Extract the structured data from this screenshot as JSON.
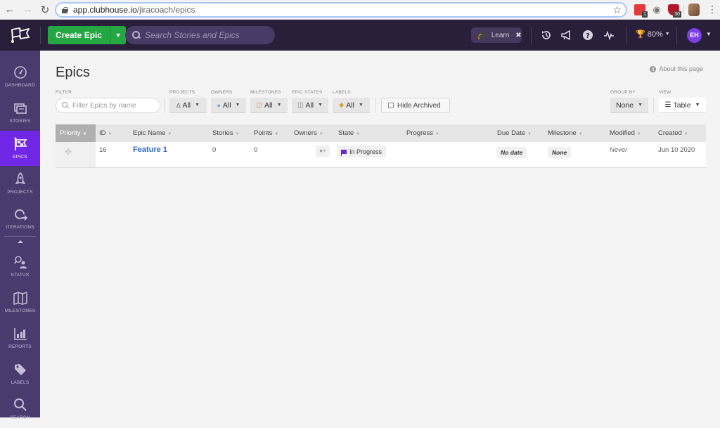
{
  "browser": {
    "url_host": "app.clubhouse.io",
    "url_path": "/jiracoach/epics",
    "extensions": [
      {
        "name": "red-extension",
        "badge": "1"
      },
      {
        "name": "camera-extension",
        "badge": ""
      },
      {
        "name": "shield-extension",
        "badge": "30"
      }
    ]
  },
  "topbar": {
    "create_label": "Create Epic",
    "search_placeholder": "Search Stories and Epics",
    "learn_label": "Learn",
    "progress_label": "80%",
    "avatar_initials": "EH"
  },
  "sidebar": {
    "items": [
      {
        "id": "dashboard",
        "label": "DASHBOARD",
        "icon": "gauge-icon"
      },
      {
        "id": "stories",
        "label": "STORIES",
        "icon": "cards-icon"
      },
      {
        "id": "epics",
        "label": "EPICS",
        "icon": "flag-icon",
        "active": true
      },
      {
        "id": "projects",
        "label": "PROJECTS",
        "icon": "rocket-icon"
      },
      {
        "id": "iterations",
        "label": "ITERATIONS",
        "icon": "loop-icon"
      },
      {
        "id": "status",
        "label": "STATUS",
        "icon": "people-icon"
      },
      {
        "id": "milestones",
        "label": "MILESTONES",
        "icon": "map-icon"
      },
      {
        "id": "reports",
        "label": "REPORTS",
        "icon": "bar-chart-icon"
      },
      {
        "id": "labels",
        "label": "LABELS",
        "icon": "tag-icon"
      },
      {
        "id": "search",
        "label": "SEARCH",
        "icon": "search-icon"
      }
    ]
  },
  "page": {
    "title": "Epics",
    "about_label": "About this page"
  },
  "filters": {
    "filter_label": "FILTER",
    "filter_placeholder": "Filter Epics by name",
    "projects": {
      "label": "PROJECTS",
      "value": "All"
    },
    "owners": {
      "label": "OWNERS",
      "value": "All"
    },
    "milestones": {
      "label": "MILESTONES",
      "value": "All"
    },
    "epic_states": {
      "label": "EPIC STATES",
      "value": "All"
    },
    "labels": {
      "label": "LABELS",
      "value": "All"
    },
    "hide_archived": "Hide Archived",
    "group_by": {
      "label": "GROUP BY",
      "value": "None"
    },
    "view": {
      "label": "VIEW",
      "value": "Table"
    }
  },
  "table": {
    "columns": [
      "Priority",
      "ID",
      "Epic Name",
      "Stories",
      "Points",
      "Owners",
      "State",
      "Progress",
      "Due Date",
      "Milestone",
      "Modified",
      "Created"
    ],
    "rows": [
      {
        "id": "16",
        "name": "Feature 1",
        "stories": "0",
        "points": "0",
        "state": "In Progress",
        "due_date": "No date",
        "milestone": "None",
        "modified": "Never",
        "created": "Jun 10 2020"
      }
    ]
  },
  "colors": {
    "topbar_bg": "#2a1f3b",
    "sidebar_bg": "#4a3a6e",
    "sidebar_active": "#7027e6",
    "create_green": "#24a643",
    "link_blue": "#2b67c6",
    "avatar_purple": "#7b3fe4"
  }
}
